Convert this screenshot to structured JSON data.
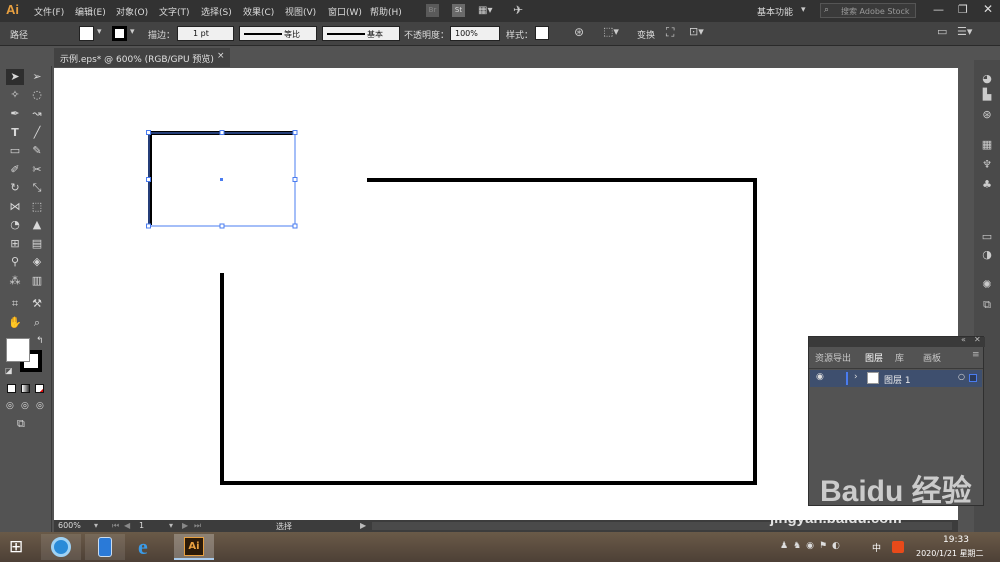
{
  "app": {
    "logo": "Ai",
    "menus": [
      "文件(F)",
      "编辑(E)",
      "对象(O)",
      "文字(T)",
      "选择(S)",
      "效果(C)",
      "视图(V)",
      "窗口(W)",
      "帮助(H)"
    ],
    "workspace": "基本功能",
    "search_placeholder": "搜索 Adobe Stock",
    "bridge_label": "Br",
    "stock_label": "St"
  },
  "control_bar": {
    "object_type": "路径",
    "stroke_label": "描边：",
    "stroke_weight": "1 pt",
    "profile_label": "等比",
    "brush_label": "基本",
    "opacity_label": "不透明度：",
    "opacity_value": "100%",
    "style_label": "样式：",
    "transform_label": "变换"
  },
  "document": {
    "tab_title": "示例.eps* @ 600% (RGB/GPU 预览)",
    "close_glyph": "×"
  },
  "layers_panel": {
    "tabs": [
      "资源导出",
      "图层",
      "库",
      "画板"
    ],
    "active_tab": "图层",
    "layer_name": "图层 1"
  },
  "status": {
    "zoom": "600%",
    "artboard": "1",
    "tool_name": "选择"
  },
  "taskbar": {
    "time": "19:33",
    "date": "2020/1/21 星期二",
    "ime": "中"
  },
  "watermark": {
    "brand": "Baidu 经验",
    "url": "jingyan.baidu.com"
  },
  "colors": {
    "selection": "#4a7cf0",
    "accent": "#e8a040"
  }
}
